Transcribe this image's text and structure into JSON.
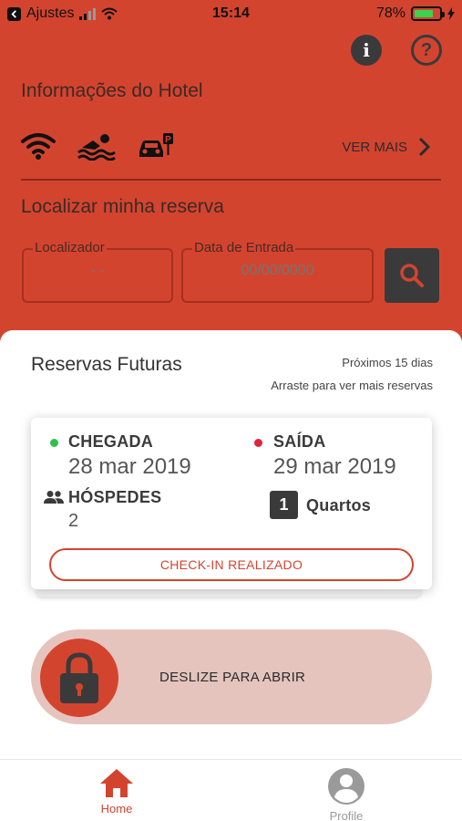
{
  "status_bar": {
    "back_app": "Ajustes",
    "time": "15:14",
    "battery": "78%",
    "battery_level": 0.78
  },
  "header": {
    "info_icon": "info-icon",
    "help_icon": "help-icon"
  },
  "hotel_info": {
    "title": "Informações do Hotel",
    "amenities": [
      "wifi-icon",
      "pool-icon",
      "parking-icon"
    ],
    "see_more": "VER MAIS"
  },
  "search": {
    "title": "Localizar minha reserva",
    "locator_label": "Localizador",
    "locator_value": "- -",
    "date_label": "Data de Entrada",
    "date_placeholder": "00/00/0000"
  },
  "future": {
    "title": "Reservas Futuras",
    "next_days": "Próximos 15 dias",
    "drag_hint": "Arraste para ver mais reservas"
  },
  "reservation": {
    "checkin_label": "CHEGADA",
    "checkin_date": "28 mar 2019",
    "checkout_label": "SAÍDA",
    "checkout_date": "29 mar 2019",
    "guests_label": "HÓSPEDES",
    "guests_value": "2",
    "rooms_count": "1",
    "rooms_label": "Quartos",
    "status_button": "CHECK-IN REALIZADO"
  },
  "unlock": {
    "label": "DESLIZE PARA ABRIR"
  },
  "tabs": [
    {
      "label": "Home",
      "icon": "home-icon"
    },
    {
      "label": "Profile",
      "icon": "profile-icon"
    }
  ],
  "colors": {
    "brand": "#d3442f",
    "dark": "#3a3a3a",
    "checkin_dot": "#2cc24a",
    "checkout_dot": "#e0243a"
  }
}
